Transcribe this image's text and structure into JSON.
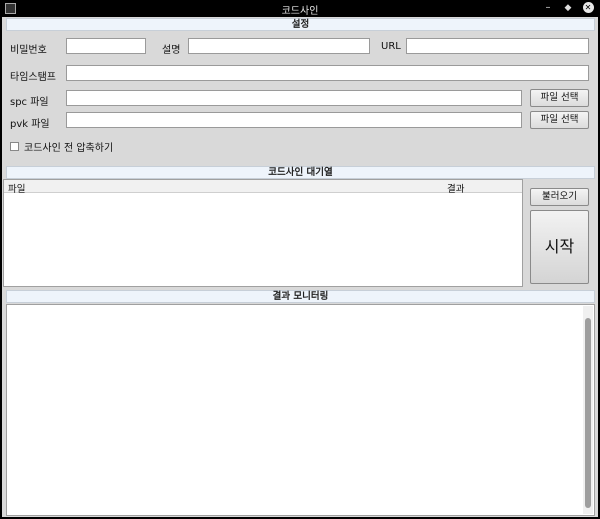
{
  "window": {
    "title": "코드사인"
  },
  "settings": {
    "header": "설정",
    "password_label": "비밀번호",
    "description_label": "설명",
    "url_label": "URL",
    "timestamp_label": "타임스탬프",
    "spc_label": "spc 파일",
    "pvk_label": "pvk 파일",
    "file_select_label": "파일 선택",
    "compress_label": "코드사인 전 압축하기",
    "password_value": "",
    "description_value": "",
    "url_value": "",
    "timestamp_value": "",
    "spc_value": "",
    "pvk_value": "",
    "compress_checked": false
  },
  "queue": {
    "header": "코드사인 대기열",
    "columns": [
      "파일",
      "결과"
    ],
    "rows": [],
    "load_label": "불러오기",
    "start_label": "시작"
  },
  "monitor": {
    "header": "결과 모니터링",
    "text": ""
  }
}
